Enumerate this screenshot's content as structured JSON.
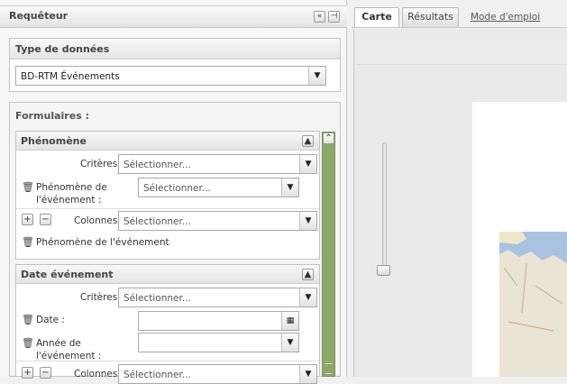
{
  "left_panel": {
    "title": "Requêteur",
    "header_icons": [
      "collapse-left-icon",
      "pin-icon"
    ]
  },
  "type_donnees": {
    "title": "Type de données",
    "selected": "BD-RTM Événements"
  },
  "formulaires": {
    "title": "Formulaires :",
    "sections": [
      {
        "title": "Phénomène",
        "criteres_label": "Critères",
        "criteres_placeholder": "Sélectionner...",
        "field_label": "Phénomène de l'événement :",
        "field_label_line1": "Phénomène de",
        "field_label_line2": "l'événement :",
        "field_placeholder": "Sélectionner...",
        "colonnes_label": "Colonnes",
        "colonnes_placeholder": "Sélectionner...",
        "column_item": "Phénomène de l'événement"
      },
      {
        "title": "Date événement",
        "criteres_label": "Critères",
        "criteres_placeholder": "Sélectionner...",
        "date_label": "Date :",
        "annee_label_line1": "Année de",
        "annee_label_line2": "l'événement :",
        "colonnes_label": "Colonnes",
        "colonnes_placeholder": "Sélectionner..."
      }
    ]
  },
  "tabs": [
    "Carte",
    "Résultats",
    "Mode d'emploi"
  ],
  "active_tab": "Carte",
  "colors": {
    "scrollbar": "#8ea86a",
    "accent_link": "#555555"
  }
}
